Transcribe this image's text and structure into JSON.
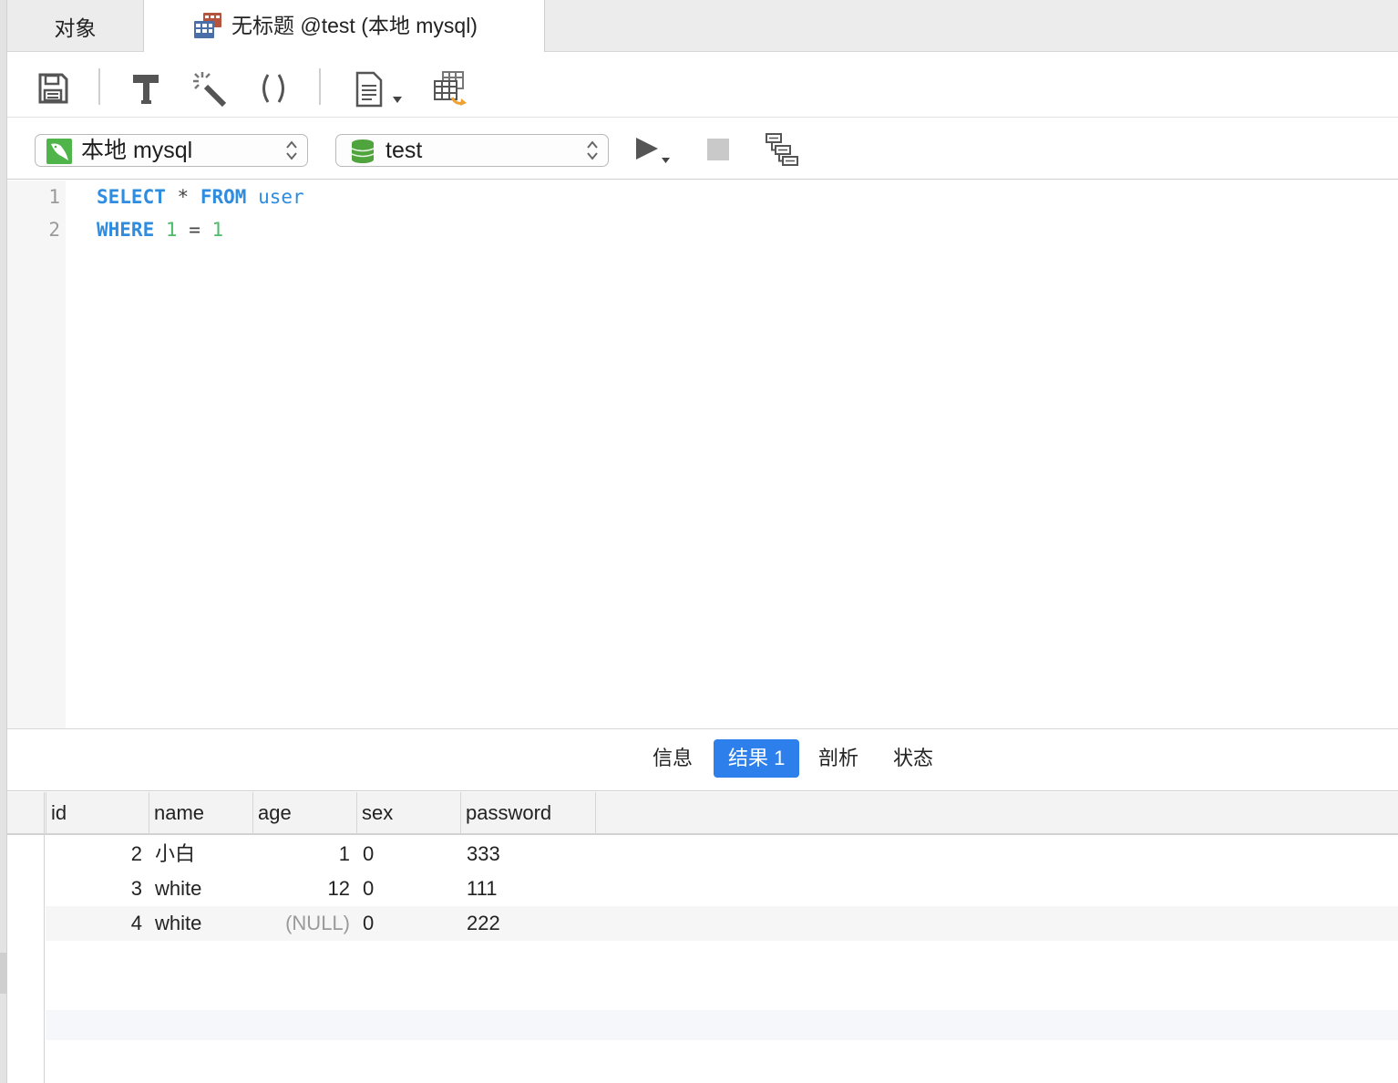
{
  "tabs": {
    "objects_label": "对象",
    "query_label": "无标题 @test (本地 mysql)"
  },
  "toolbar": {
    "icons": [
      "save-icon",
      "beautify-hammer-icon",
      "magic-wand-icon",
      "parentheses-icon",
      "snippet-document-icon",
      "export-table-icon"
    ]
  },
  "connection": {
    "connection_value": "本地 mysql",
    "database_value": "test"
  },
  "editor": {
    "line_numbers": [
      "1",
      "2"
    ],
    "line1": {
      "kw1": "SELECT",
      "op": "*",
      "kw2": "FROM",
      "ident": "user"
    },
    "line2": {
      "kw": "WHERE",
      "lhs": "1",
      "op": "=",
      "rhs": "1"
    }
  },
  "result_tabs": {
    "info": "信息",
    "result1": "结果 1",
    "profile": "剖析",
    "status": "状态",
    "active": "结果 1"
  },
  "grid": {
    "columns": [
      "id",
      "name",
      "age",
      "sex",
      "password"
    ],
    "rows": [
      {
        "id": "2",
        "name": "小白",
        "age": "1",
        "sex": "0",
        "password": "333"
      },
      {
        "id": "3",
        "name": "white",
        "age": "12",
        "sex": "0",
        "password": "111"
      },
      {
        "id": "4",
        "name": "white",
        "age": "(NULL)",
        "sex": "0",
        "password": "222"
      }
    ]
  },
  "colors": {
    "accent": "#2d80ec",
    "sql_keyword": "#2f8cdf",
    "sql_number": "#4dbb67",
    "null_text": "#9a9a9a"
  }
}
